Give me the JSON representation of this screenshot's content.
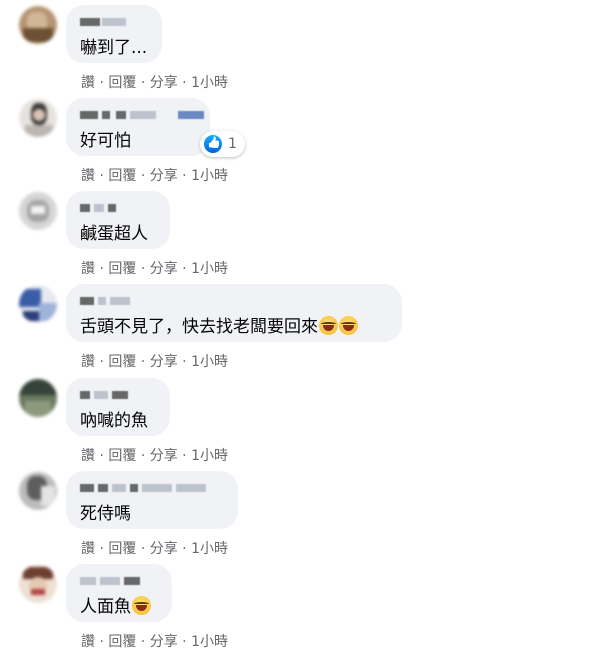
{
  "comments": [
    {
      "text": "嚇到了...",
      "avatar_colors": [
        "#a88a6a",
        "#c9a98a",
        "#7a5a3a"
      ],
      "bubble_width": 96
    },
    {
      "text": "好可怕",
      "avatar_colors": [
        "#e8e4e0",
        "#bdb6b0",
        "#404040"
      ],
      "bubble_width": 144
    },
    {
      "text": "鹹蛋超人",
      "avatar_colors": [
        "#d8d8d8",
        "#9a9a9a",
        "#efefef"
      ],
      "bubble_width": 104
    },
    {
      "text": "舌頭不見了，快去找老闆要回來",
      "avatar_colors": [
        "#3a5aa8",
        "#e8eaf0",
        "#9fb4d8"
      ],
      "bubble_width": 336
    },
    {
      "text": "吶喊的魚",
      "avatar_colors": [
        "#4a5a40",
        "#2a3a2a",
        "#8a9a7a"
      ],
      "bubble_width": 104
    },
    {
      "text": "死侍嗎",
      "avatar_colors": [
        "#b8b8b8",
        "#6a6a6a",
        "#e0e0e0"
      ],
      "bubble_width": 172
    },
    {
      "text": "人面魚",
      "avatar_colors": [
        "#e8d8c8",
        "#7a4a3a",
        "#f4e8e0"
      ],
      "bubble_width": 106
    }
  ],
  "actions": {
    "like": "讚",
    "reply": "回覆",
    "share": "分享",
    "time": "1小時",
    "sep": "·"
  },
  "reaction": {
    "count": "1",
    "icon": "like-icon",
    "color": "#1877f2"
  }
}
